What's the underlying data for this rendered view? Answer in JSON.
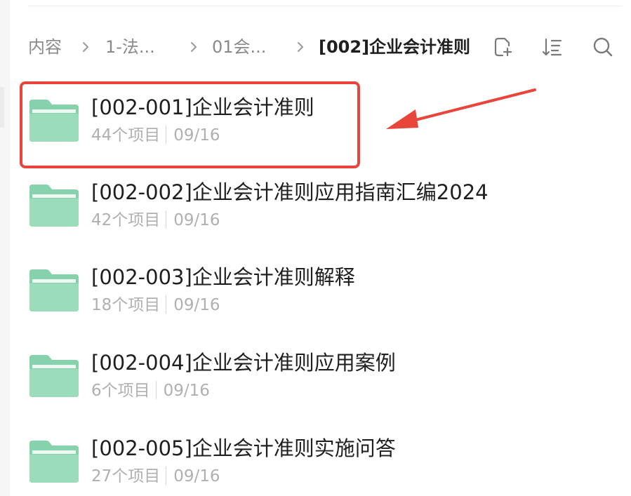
{
  "breadcrumb": {
    "items": [
      "内容",
      "1-法...",
      "01会..."
    ],
    "current": "[002]企业会计准则"
  },
  "toolbar": {
    "icons": [
      "new-file-icon",
      "sort-icon",
      "search-icon"
    ]
  },
  "colors": {
    "folder": "#7fcfa8",
    "highlight": "#e8463b",
    "text_primary": "#1f1f1f",
    "text_secondary": "#b0b0b0"
  },
  "folders": [
    {
      "name": "[002-001]企业会计准则",
      "count": "44个项目",
      "date": "09/16",
      "highlighted": true
    },
    {
      "name": "[002-002]企业会计准则应用指南汇编2024",
      "count": "42个项目",
      "date": "09/16"
    },
    {
      "name": "[002-003]企业会计准则解释",
      "count": "18个项目",
      "date": "09/16"
    },
    {
      "name": "[002-004]企业会计准则应用案例",
      "count": "6个项目",
      "date": "09/16"
    },
    {
      "name": "[002-005]企业会计准则实施问答",
      "count": "27个项目",
      "date": "09/16"
    }
  ]
}
